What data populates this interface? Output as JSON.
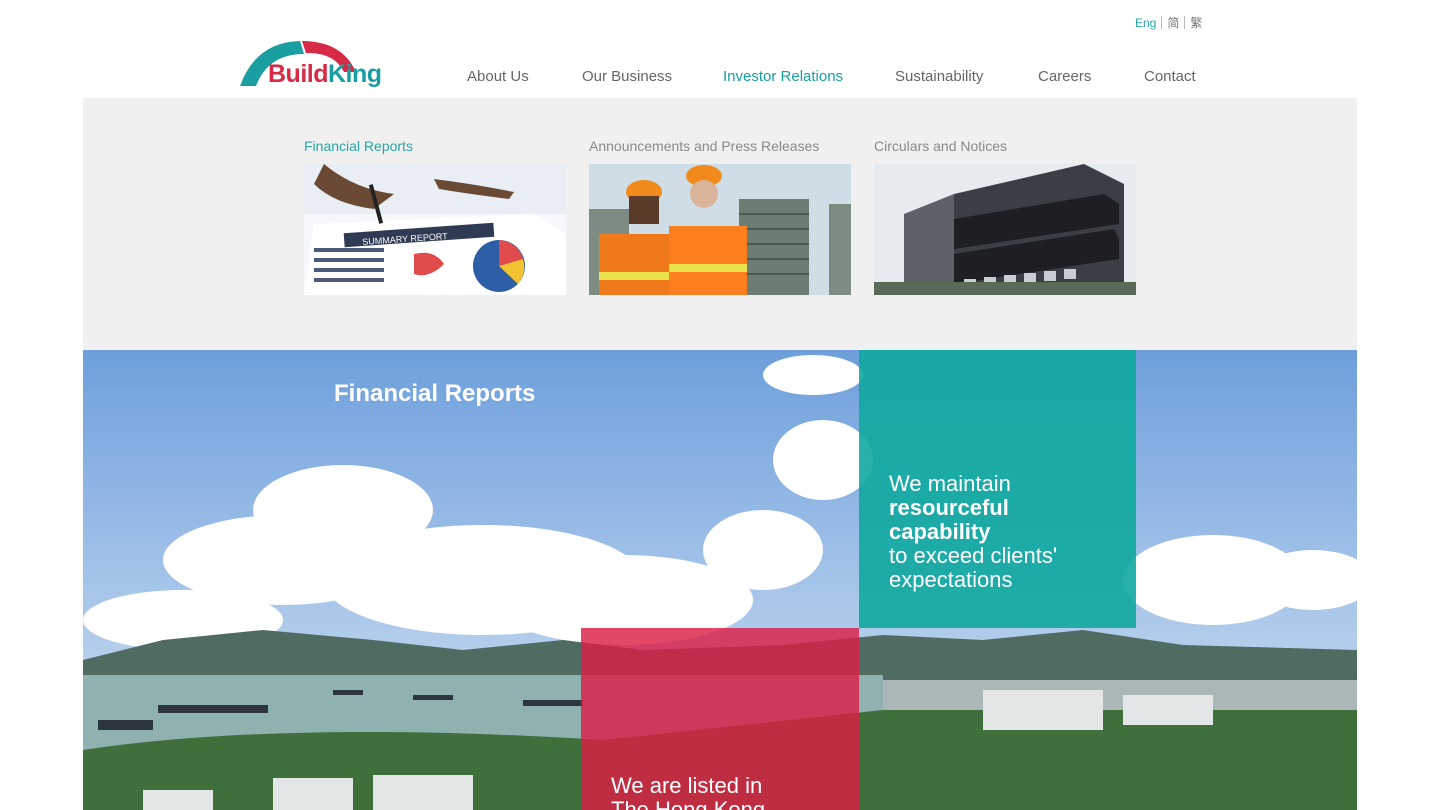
{
  "lang": {
    "items": [
      {
        "label": "Eng",
        "active": true
      },
      {
        "label": "简",
        "active": false
      },
      {
        "label": "繁",
        "active": false
      }
    ]
  },
  "logo": {
    "word1": "Build",
    "word2": "King"
  },
  "nav": {
    "items": [
      {
        "label": "About Us",
        "active": false
      },
      {
        "label": "Our Business",
        "active": false
      },
      {
        "label": "Investor Relations",
        "active": true
      },
      {
        "label": "Sustainability",
        "active": false
      },
      {
        "label": "Careers",
        "active": false
      },
      {
        "label": "Contact",
        "active": false
      }
    ]
  },
  "dropdown": {
    "items": [
      {
        "label": "Financial Reports",
        "active": true,
        "image": "summary-report-photo"
      },
      {
        "label": "Announcements and Press Releases",
        "active": false,
        "image": "construction-workers-photo"
      },
      {
        "label": "Circulars and Notices",
        "active": false,
        "image": "office-building-photo"
      }
    ]
  },
  "hero": {
    "title": "Financial Reports",
    "teal": {
      "line1": "We maintain",
      "bold": "resourceful capability",
      "line3": "to exceed clients'",
      "line4": "expectations"
    },
    "red": {
      "line1": "We are listed in",
      "line2": "The Hong Kong"
    }
  },
  "colors": {
    "teal": "#17a0a3",
    "red": "#d62a46",
    "panel": "#f0f0f0"
  }
}
